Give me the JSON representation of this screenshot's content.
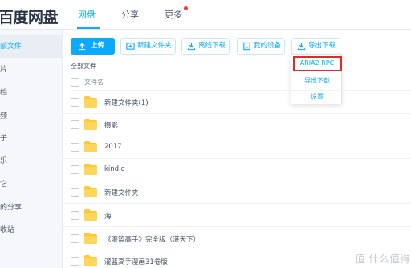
{
  "header": {
    "logo": "百度网盘",
    "nav": [
      {
        "label": "网盘",
        "active": true
      },
      {
        "label": "分享",
        "active": false
      },
      {
        "label": "更多",
        "active": false
      }
    ]
  },
  "sidebar": {
    "items": [
      "部文件",
      "片",
      "档",
      "频",
      "子",
      "乐",
      "它",
      "的分享",
      "收站"
    ]
  },
  "toolbar": {
    "upload": "上传",
    "new_folder": "新建文件夹",
    "offline_download": "离线下载",
    "my_devices": "我的设备",
    "export_download": "导出下载"
  },
  "dropdown": {
    "items": [
      "ARIA2 RPC",
      "导出下载",
      "设置"
    ]
  },
  "list": {
    "breadcrumb": "全部文件",
    "column_name": "文件名",
    "files": [
      "新建文件夹(1)",
      "摄影",
      "2017",
      "kindle",
      "新建文件夹",
      "海",
      "《灌篮高手》完全版（湛天下）",
      "灌篮高手漫画31卷版"
    ]
  },
  "watermark": "值 什么值得买",
  "colors": {
    "accent": "#09aaff",
    "folder": "#ffc731",
    "highlight": "#e02b2b"
  }
}
